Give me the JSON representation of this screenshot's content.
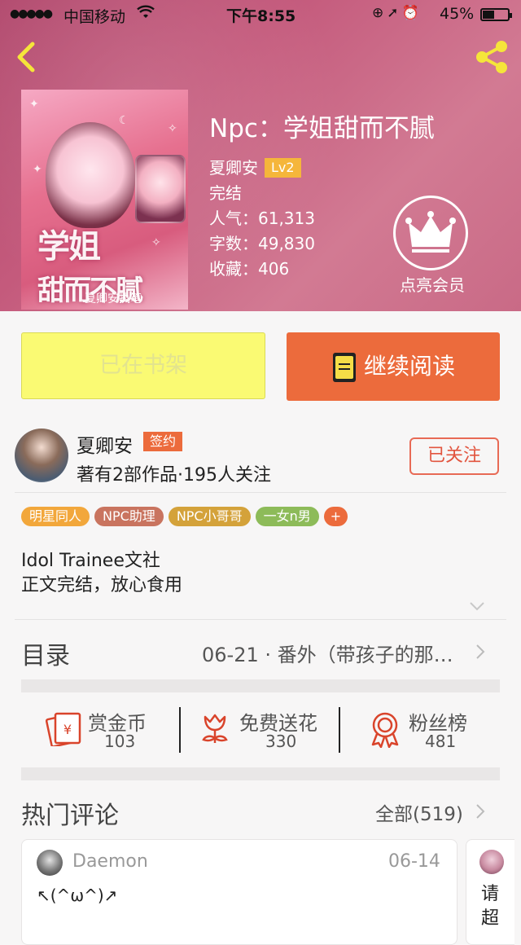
{
  "status_bar": {
    "carrier": "中国移动",
    "time": "下午8:55",
    "battery": "45%",
    "battery_level": 0.45
  },
  "book": {
    "title": "Npc：学姐甜而不腻",
    "author": "夏卿安",
    "level_badge": "Lv2",
    "status": "完结",
    "popularity": "人气：61,313",
    "word_count": "字数：49,830",
    "favorites": "收藏：406",
    "cover": {
      "title_line1": "学姐",
      "title_line2": "甜而不腻",
      "author_text": "夏卿安执笔"
    }
  },
  "vip": {
    "label": "点亮会员",
    "icon": "crown-icon"
  },
  "actions": {
    "shelf_label": "已在书架",
    "read_label": "继续阅读"
  },
  "author_block": {
    "name": "夏卿安",
    "badge": "签约",
    "stats": "著有2部作品·195人关注",
    "follow_label": "已关注"
  },
  "tags": [
    {
      "label": "明星同人",
      "color": "#f2a73b"
    },
    {
      "label": "NPC助理",
      "color": "#c9745f"
    },
    {
      "label": "NPC小哥哥",
      "color": "#d4a23a"
    },
    {
      "label": "一女n男",
      "color": "#8dbb59"
    },
    {
      "label": "+",
      "color": "#ec6b3c"
    }
  ],
  "description": {
    "line1": "Idol Trainee文社",
    "line2": "正文完结，放心食用"
  },
  "toc": {
    "label": "目录",
    "latest": "06-21 · 番外（带孩子的那…"
  },
  "stats": {
    "reward": {
      "label": "赏金币",
      "value": "103"
    },
    "flower": {
      "label": "免费送花",
      "value": "330"
    },
    "fans": {
      "label": "粉丝榜",
      "value": "481"
    }
  },
  "comments": {
    "section_title": "热门评论",
    "all_label": "全部(519)",
    "items": [
      {
        "user": "Daemon",
        "date": "06-14",
        "text": "↖(^ω^)↗"
      },
      {
        "user": "",
        "date": "",
        "text": "请超"
      }
    ]
  },
  "colors": {
    "accent": "#ec6b3c",
    "shelf": "#fafa73",
    "header": "#c45a7c"
  }
}
